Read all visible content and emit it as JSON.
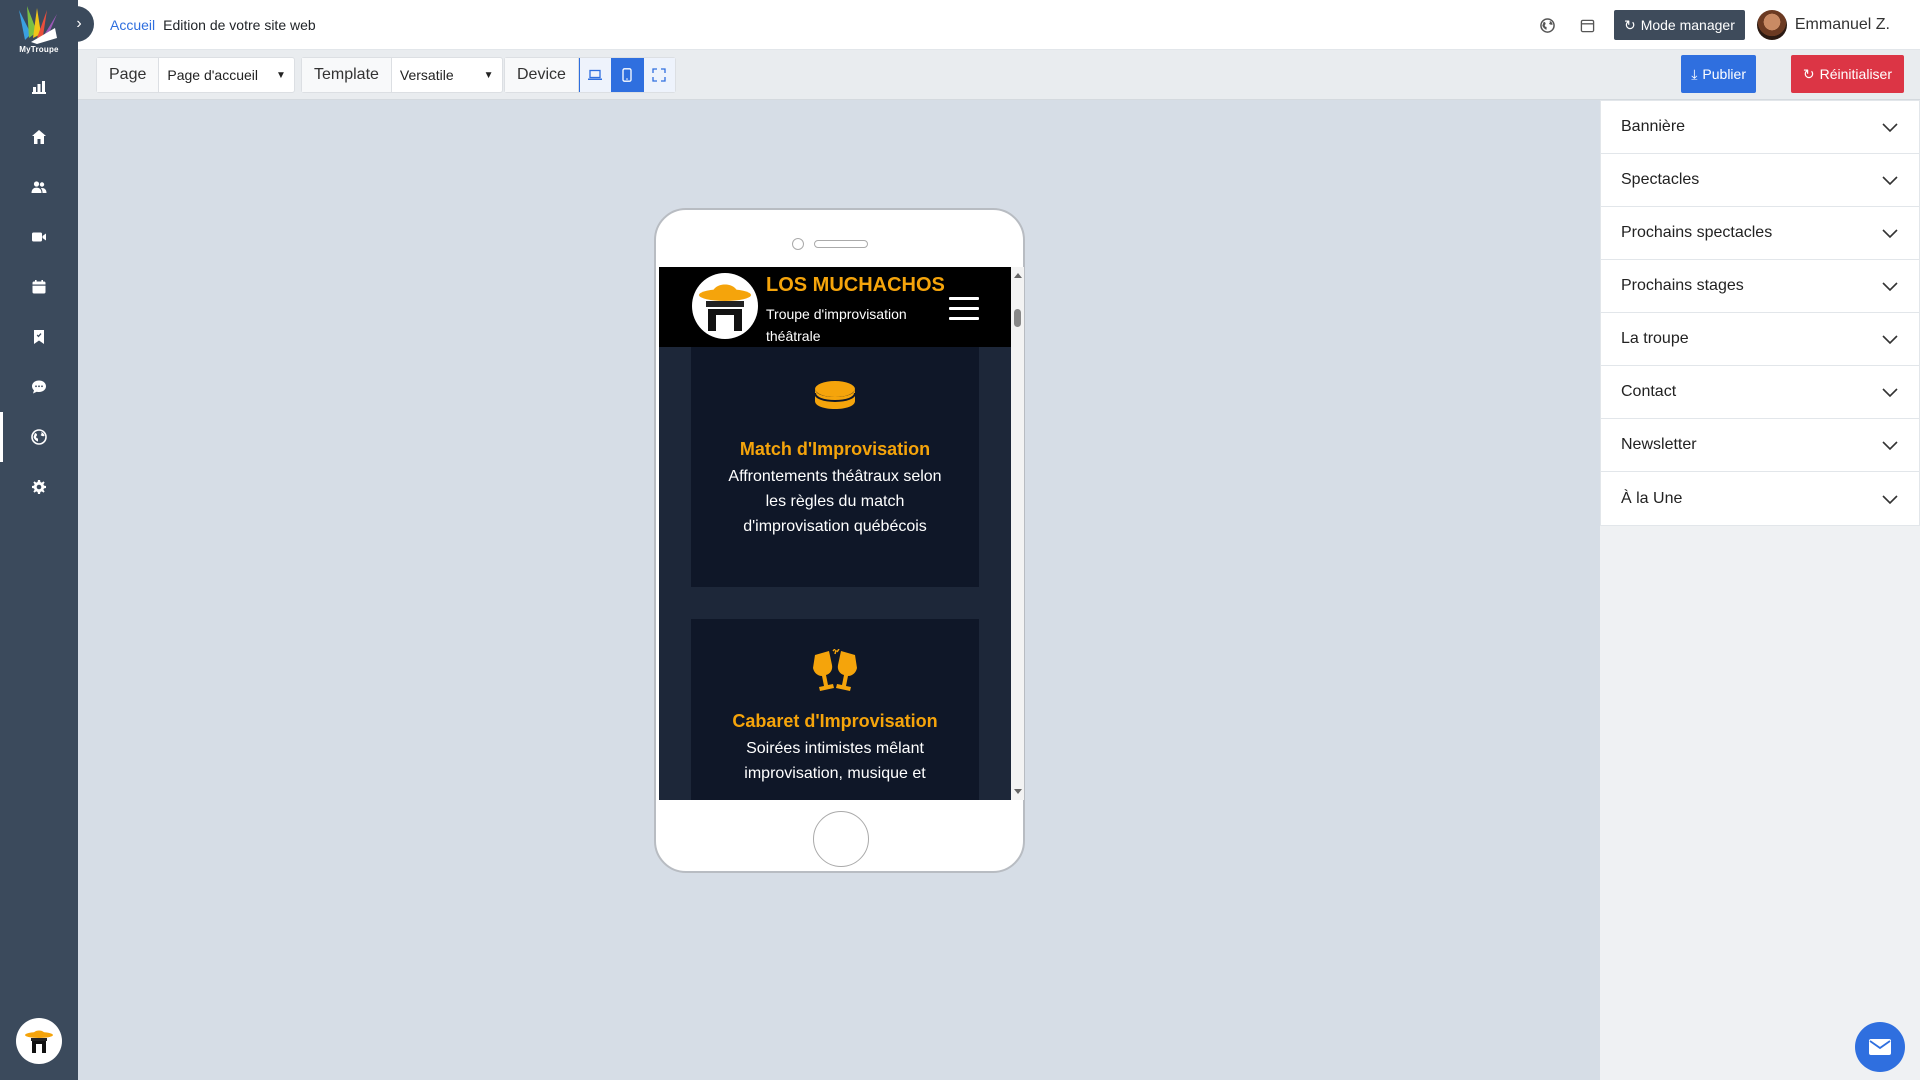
{
  "app": {
    "logo_text": "MyTroupe",
    "colors": {
      "sidebar": "#3b4a5c",
      "primary": "#2f6fdf",
      "danger": "#dc3545",
      "accent": "#f5a40b"
    }
  },
  "sidebar": {
    "items": [
      {
        "icon": "bar-chart-icon"
      },
      {
        "icon": "home-icon"
      },
      {
        "icon": "users-icon"
      },
      {
        "icon": "video-camera-icon"
      },
      {
        "icon": "calendar-icon"
      },
      {
        "icon": "bookmark-icon"
      },
      {
        "icon": "chat-icon"
      },
      {
        "icon": "globe-icon",
        "active": true
      },
      {
        "icon": "gear-icon"
      }
    ]
  },
  "topbar": {
    "breadcrumb_home": "Accueil",
    "breadcrumb_current": "Edition de votre site web",
    "manager_label": "Mode manager",
    "user_name": "Emmanuel Z."
  },
  "toolbar": {
    "page_label": "Page",
    "page_value": "Page d'accueil",
    "template_label": "Template",
    "template_value": "Versatile",
    "device_label": "Device",
    "publish_label": "Publier",
    "reset_label": "Réinitialiser"
  },
  "preview": {
    "site_title": "LOS MUCHACHOS",
    "site_subtitle": "Troupe d'improvisation théâtrale",
    "cards": [
      {
        "title": "Match d'Improvisation",
        "text": "Affrontements théâtraux selon les règles du match d'improvisation québécois"
      },
      {
        "title": "Cabaret d'Improvisation",
        "text": "Soirées intimistes mêlant improvisation, musique et"
      }
    ]
  },
  "panel": {
    "sections": [
      "Bannière",
      "Spectacles",
      "Prochains spectacles",
      "Prochains stages",
      "La troupe",
      "Contact",
      "Newsletter",
      "À la Une"
    ]
  }
}
